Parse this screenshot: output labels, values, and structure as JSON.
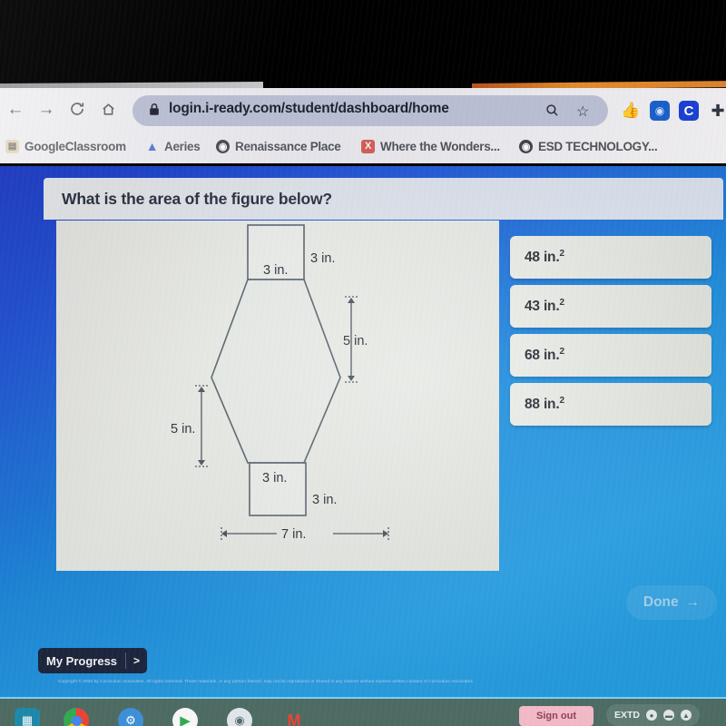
{
  "browser": {
    "nav": {
      "back_icon": "arrow-left-icon",
      "forward_icon": "arrow-right-icon",
      "reload_icon": "reload-icon",
      "home_icon": "home-icon"
    },
    "omnibox": {
      "lock_icon": "lock-icon",
      "url": "login.i-ready.com/student/dashboard/home",
      "search_icon": "search-icon",
      "star_icon": "star-icon"
    },
    "extensions": [
      {
        "name": "thumbs-up-extension-icon",
        "glyph": "👍"
      },
      {
        "name": "blue-square-extension-icon",
        "glyph": "◉"
      },
      {
        "name": "c-extension-icon",
        "glyph": "C"
      },
      {
        "name": "puzzle-extension-icon",
        "glyph": "🧩"
      }
    ],
    "bookmarks": [
      {
        "label": "GoogleClassroom",
        "icon": "classroom-icon",
        "glyph": "▤"
      },
      {
        "label": "Aeries",
        "icon": "aeries-icon",
        "glyph": "A"
      },
      {
        "label": "Renaissance Place",
        "icon": "globe-icon",
        "glyph": "◐"
      },
      {
        "label": "Where the Wonders...",
        "icon": "wonders-icon",
        "glyph": "X"
      },
      {
        "label": "ESD TECHNOLOGY...",
        "icon": "globe-icon",
        "glyph": "◐"
      }
    ]
  },
  "app": {
    "question": "What is the area of the figure below?",
    "choices": [
      {
        "value": "48",
        "unit": "in.",
        "exponent": "2"
      },
      {
        "value": "43",
        "unit": "in.",
        "exponent": "2"
      },
      {
        "value": "68",
        "unit": "in.",
        "exponent": "2"
      },
      {
        "value": "88",
        "unit": "in.",
        "exponent": "2"
      }
    ],
    "done_label": "Done",
    "done_arrow": "→",
    "progress_label": "My Progress",
    "progress_arrow": ">",
    "copyright": "Copyright © 2020 by Curriculum Associates. All rights reserved. These materials, or any portion thereof, may not be reproduced or shared in any manner without express written consent of Curriculum Associates."
  },
  "figure": {
    "type": "composite-polygon",
    "description": "Hexagon with a square attached to the top edge and a square attached to the bottom edge",
    "labels": {
      "top_square_width": "3 in.",
      "top_square_height": "3 in.",
      "right_slant_height": "5 in.",
      "left_slant_height": "5 in.",
      "bottom_square_width": "3 in.",
      "bottom_square_height": "3 in.",
      "hexagon_width": "7 in."
    }
  },
  "taskbar": {
    "icons": [
      {
        "name": "launcher-icon",
        "glyph": "▦"
      },
      {
        "name": "chrome-icon",
        "glyph": ""
      },
      {
        "name": "apps-icon",
        "glyph": "⚙"
      },
      {
        "name": "play-store-icon",
        "glyph": "▶"
      },
      {
        "name": "camera-icon",
        "glyph": "◉"
      },
      {
        "name": "gmail-icon",
        "glyph": "M"
      }
    ],
    "sign_out_label": "Sign out",
    "status_label": "EXTD",
    "status_icons": [
      {
        "name": "person-icon",
        "glyph": "●"
      },
      {
        "name": "battery-icon",
        "glyph": "▬"
      },
      {
        "name": "wifi-icon",
        "glyph": "▲"
      }
    ]
  }
}
